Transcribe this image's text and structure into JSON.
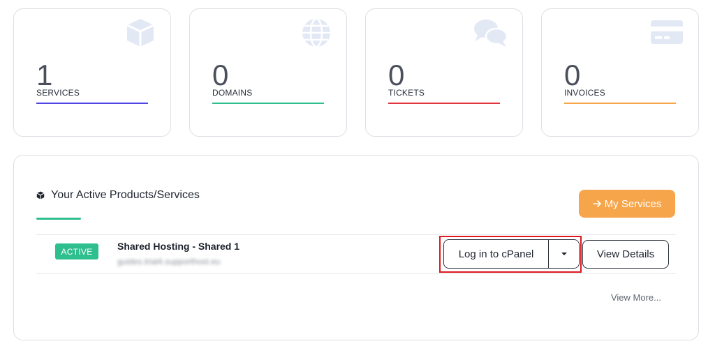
{
  "stats": [
    {
      "count": "1",
      "label": "SERVICES",
      "icon": "cube-icon",
      "accent": "#4f46e5"
    },
    {
      "count": "0",
      "label": "DOMAINS",
      "icon": "globe-icon",
      "accent": "#2fbf8f"
    },
    {
      "count": "0",
      "label": "TICKETS",
      "icon": "chat-bubbles-icon",
      "accent": "#e0353e"
    },
    {
      "count": "0",
      "label": "INVOICES",
      "icon": "credit-card-icon",
      "accent": "#f7a54a"
    }
  ],
  "panel": {
    "title": "Your Active Products/Services",
    "my_services_label": "My Services",
    "product": {
      "status": "ACTIVE",
      "name": "Shared Hosting - Shared 1",
      "domain": "guides.trial4.supporthost.eu"
    },
    "login_label": "Log in to cPanel",
    "view_details_label": "View Details",
    "view_more_label": "View More..."
  },
  "colors": {
    "icon_tint": "#e3e8f5",
    "success": "#2fbf8f",
    "cta": "#f7a54a",
    "highlight": "#e0161f"
  }
}
